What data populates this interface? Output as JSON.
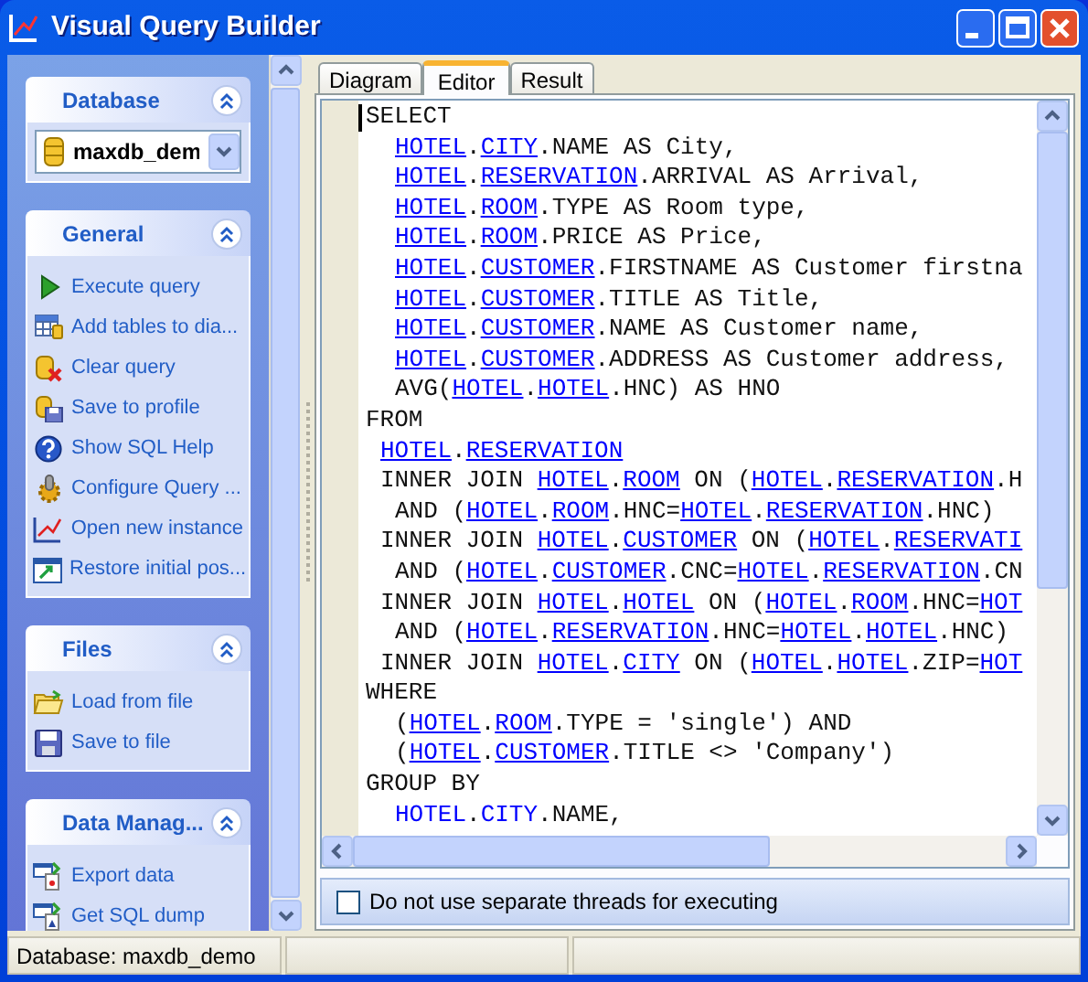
{
  "window": {
    "title": "Visual Query Builder"
  },
  "task_pane": {
    "groups": [
      {
        "title": "Database",
        "expanded": true,
        "database": {
          "value": "maxdb_dem"
        }
      },
      {
        "title": "General",
        "expanded": true,
        "items": [
          "Execute query",
          "Add tables to dia...",
          "Clear query",
          "Save to profile",
          "Show SQL Help",
          "Configure Query ...",
          "Open new instance",
          "Restore initial pos..."
        ]
      },
      {
        "title": "Files",
        "expanded": true,
        "items": [
          "Load from file",
          "Save to file"
        ]
      },
      {
        "title": "Data Manag...",
        "expanded": true,
        "items": [
          "Export data",
          "Get SQL dump"
        ]
      }
    ]
  },
  "tabs": [
    {
      "label": "Diagram",
      "selected": false
    },
    {
      "label": "Editor",
      "selected": true
    },
    {
      "label": "Result",
      "selected": false
    }
  ],
  "editor": {
    "lines": [
      {
        "kind": "clause",
        "segments": [
          {
            "kind": "plain",
            "text": "SELECT"
          }
        ]
      },
      {
        "kind": "item",
        "segments": [
          {
            "kind": "link",
            "text": "HOTEL"
          },
          {
            "kind": "plain",
            "text": "."
          },
          {
            "kind": "link",
            "text": "CITY"
          },
          {
            "kind": "plain",
            "text": ".NAME AS City,"
          }
        ]
      },
      {
        "kind": "item",
        "segments": [
          {
            "kind": "link",
            "text": "HOTEL"
          },
          {
            "kind": "plain",
            "text": "."
          },
          {
            "kind": "link",
            "text": "RESERVATION"
          },
          {
            "kind": "plain",
            "text": ".ARRIVAL AS Arrival,"
          }
        ]
      },
      {
        "kind": "item",
        "segments": [
          {
            "kind": "link",
            "text": "HOTEL"
          },
          {
            "kind": "plain",
            "text": "."
          },
          {
            "kind": "link",
            "text": "ROOM"
          },
          {
            "kind": "plain",
            "text": ".TYPE AS Room type,"
          }
        ]
      },
      {
        "kind": "item",
        "segments": [
          {
            "kind": "link",
            "text": "HOTEL"
          },
          {
            "kind": "plain",
            "text": "."
          },
          {
            "kind": "link",
            "text": "ROOM"
          },
          {
            "kind": "plain",
            "text": ".PRICE AS Price,"
          }
        ]
      },
      {
        "kind": "item",
        "segments": [
          {
            "kind": "link",
            "text": "HOTEL"
          },
          {
            "kind": "plain",
            "text": "."
          },
          {
            "kind": "link",
            "text": "CUSTOMER"
          },
          {
            "kind": "plain",
            "text": ".FIRSTNAME AS Customer firstna"
          }
        ]
      },
      {
        "kind": "item",
        "segments": [
          {
            "kind": "link",
            "text": "HOTEL"
          },
          {
            "kind": "plain",
            "text": "."
          },
          {
            "kind": "link",
            "text": "CUSTOMER"
          },
          {
            "kind": "plain",
            "text": ".TITLE AS Title,"
          }
        ]
      },
      {
        "kind": "item",
        "segments": [
          {
            "kind": "link",
            "text": "HOTEL"
          },
          {
            "kind": "plain",
            "text": "."
          },
          {
            "kind": "link",
            "text": "CUSTOMER"
          },
          {
            "kind": "plain",
            "text": ".NAME AS Customer name,"
          }
        ]
      },
      {
        "kind": "item",
        "segments": [
          {
            "kind": "link",
            "text": "HOTEL"
          },
          {
            "kind": "plain",
            "text": "."
          },
          {
            "kind": "link",
            "text": "CUSTOMER"
          },
          {
            "kind": "plain",
            "text": ".ADDRESS AS Customer address,"
          }
        ]
      },
      {
        "kind": "item",
        "segments": [
          {
            "kind": "plain",
            "text": "AVG("
          },
          {
            "kind": "link",
            "text": "HOTEL"
          },
          {
            "kind": "plain",
            "text": "."
          },
          {
            "kind": "link",
            "text": "HOTEL"
          },
          {
            "kind": "plain",
            "text": ".HNC) AS HNO"
          }
        ]
      },
      {
        "kind": "clause",
        "segments": [
          {
            "kind": "plain",
            "text": "FROM"
          }
        ]
      },
      {
        "kind": "table",
        "segments": [
          {
            "kind": "link",
            "text": "HOTEL"
          },
          {
            "kind": "plain",
            "text": "."
          },
          {
            "kind": "link",
            "text": "RESERVATION"
          }
        ]
      },
      {
        "kind": "table",
        "segments": [
          {
            "kind": "plain",
            "text": "INNER JOIN "
          },
          {
            "kind": "link",
            "text": "HOTEL"
          },
          {
            "kind": "plain",
            "text": "."
          },
          {
            "kind": "link",
            "text": "ROOM"
          },
          {
            "kind": "plain",
            "text": " ON ("
          },
          {
            "kind": "link",
            "text": "HOTEL"
          },
          {
            "kind": "plain",
            "text": "."
          },
          {
            "kind": "link",
            "text": "RESERVATION"
          },
          {
            "kind": "plain",
            "text": ".H"
          }
        ]
      },
      {
        "kind": "item",
        "segments": [
          {
            "kind": "plain",
            "text": "AND ("
          },
          {
            "kind": "link",
            "text": "HOTEL"
          },
          {
            "kind": "plain",
            "text": "."
          },
          {
            "kind": "link",
            "text": "ROOM"
          },
          {
            "kind": "plain",
            "text": ".HNC="
          },
          {
            "kind": "link",
            "text": "HOTEL"
          },
          {
            "kind": "plain",
            "text": "."
          },
          {
            "kind": "link",
            "text": "RESERVATION"
          },
          {
            "kind": "plain",
            "text": ".HNC)"
          }
        ]
      },
      {
        "kind": "table",
        "segments": [
          {
            "kind": "plain",
            "text": "INNER JOIN "
          },
          {
            "kind": "link",
            "text": "HOTEL"
          },
          {
            "kind": "plain",
            "text": "."
          },
          {
            "kind": "link",
            "text": "CUSTOMER"
          },
          {
            "kind": "plain",
            "text": " ON ("
          },
          {
            "kind": "link",
            "text": "HOTEL"
          },
          {
            "kind": "plain",
            "text": "."
          },
          {
            "kind": "link",
            "text": "RESERVATI"
          }
        ]
      },
      {
        "kind": "item",
        "segments": [
          {
            "kind": "plain",
            "text": "AND ("
          },
          {
            "kind": "link",
            "text": "HOTEL"
          },
          {
            "kind": "plain",
            "text": "."
          },
          {
            "kind": "link",
            "text": "CUSTOMER"
          },
          {
            "kind": "plain",
            "text": ".CNC="
          },
          {
            "kind": "link",
            "text": "HOTEL"
          },
          {
            "kind": "plain",
            "text": "."
          },
          {
            "kind": "link",
            "text": "RESERVATION"
          },
          {
            "kind": "plain",
            "text": ".CN"
          }
        ]
      },
      {
        "kind": "table",
        "segments": [
          {
            "kind": "plain",
            "text": "INNER JOIN "
          },
          {
            "kind": "link",
            "text": "HOTEL"
          },
          {
            "kind": "plain",
            "text": "."
          },
          {
            "kind": "link",
            "text": "HOTEL"
          },
          {
            "kind": "plain",
            "text": " ON ("
          },
          {
            "kind": "link",
            "text": "HOTEL"
          },
          {
            "kind": "plain",
            "text": "."
          },
          {
            "kind": "link",
            "text": "ROOM"
          },
          {
            "kind": "plain",
            "text": ".HNC="
          },
          {
            "kind": "link",
            "text": "HOT"
          }
        ]
      },
      {
        "kind": "item",
        "segments": [
          {
            "kind": "plain",
            "text": "AND ("
          },
          {
            "kind": "link",
            "text": "HOTEL"
          },
          {
            "kind": "plain",
            "text": "."
          },
          {
            "kind": "link",
            "text": "RESERVATION"
          },
          {
            "kind": "plain",
            "text": ".HNC="
          },
          {
            "kind": "link",
            "text": "HOTEL"
          },
          {
            "kind": "plain",
            "text": "."
          },
          {
            "kind": "link",
            "text": "HOTEL"
          },
          {
            "kind": "plain",
            "text": ".HNC)"
          }
        ]
      },
      {
        "kind": "table",
        "segments": [
          {
            "kind": "plain",
            "text": "INNER JOIN "
          },
          {
            "kind": "link",
            "text": "HOTEL"
          },
          {
            "kind": "plain",
            "text": "."
          },
          {
            "kind": "link",
            "text": "CITY"
          },
          {
            "kind": "plain",
            "text": " ON ("
          },
          {
            "kind": "link",
            "text": "HOTEL"
          },
          {
            "kind": "plain",
            "text": "."
          },
          {
            "kind": "link",
            "text": "HOTEL"
          },
          {
            "kind": "plain",
            "text": ".ZIP="
          },
          {
            "kind": "link",
            "text": "HOT"
          }
        ]
      },
      {
        "kind": "clause",
        "segments": [
          {
            "kind": "plain",
            "text": "WHERE"
          }
        ]
      },
      {
        "kind": "item",
        "segments": [
          {
            "kind": "plain",
            "text": "("
          },
          {
            "kind": "link",
            "text": "HOTEL"
          },
          {
            "kind": "plain",
            "text": "."
          },
          {
            "kind": "link",
            "text": "ROOM"
          },
          {
            "kind": "plain",
            "text": ".TYPE = 'single') AND"
          }
        ]
      },
      {
        "kind": "item",
        "segments": [
          {
            "kind": "plain",
            "text": "("
          },
          {
            "kind": "link",
            "text": "HOTEL"
          },
          {
            "kind": "plain",
            "text": "."
          },
          {
            "kind": "link",
            "text": "CUSTOMER"
          },
          {
            "kind": "plain",
            "text": ".TITLE <> 'Company')"
          }
        ]
      },
      {
        "kind": "clause",
        "segments": [
          {
            "kind": "plain",
            "text": "GROUP BY"
          }
        ]
      },
      {
        "kind": "item",
        "segments": [
          {
            "kind": "ident",
            "text": "HOTEL"
          },
          {
            "kind": "plain",
            "text": "."
          },
          {
            "kind": "ident",
            "text": "CITY"
          },
          {
            "kind": "plain",
            "text": ".NAME,"
          }
        ]
      }
    ]
  },
  "option": {
    "label": "Do not use separate threads for executing",
    "checked": false
  },
  "status_bar": {
    "panels": [
      "Database: maxdb_demo"
    ]
  }
}
